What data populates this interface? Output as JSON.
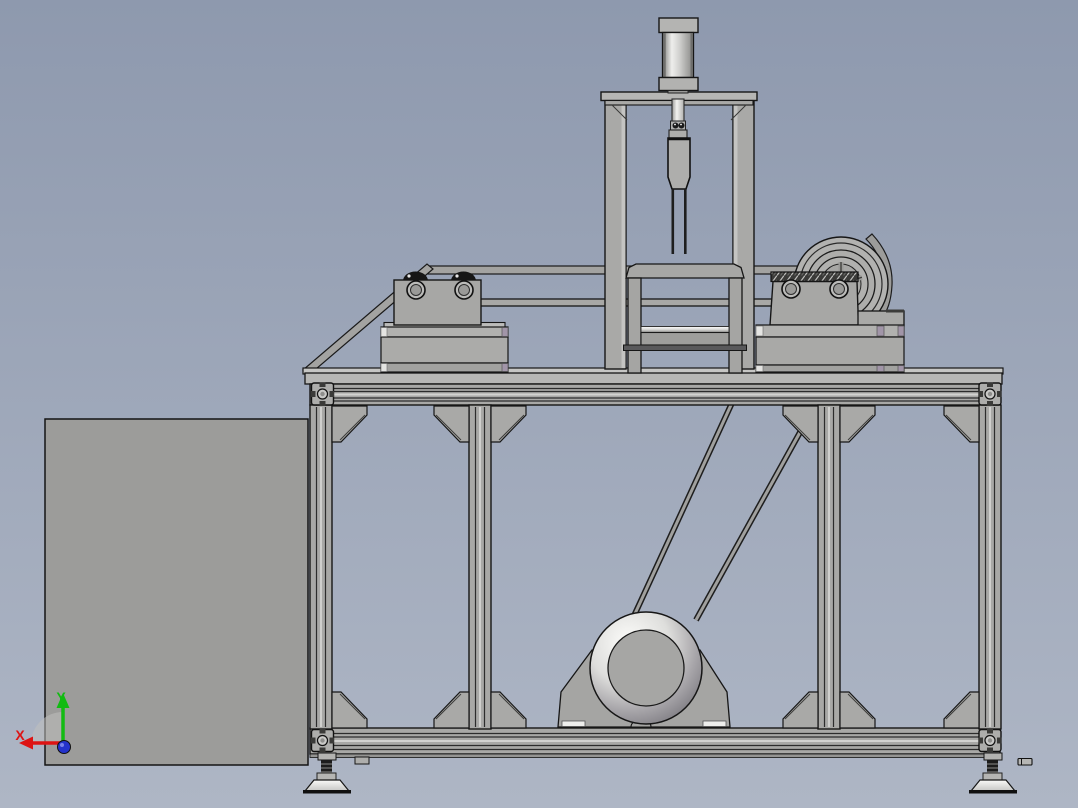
{
  "viewport": {
    "type": "cad-3d-viewport",
    "view_name": "front-view-machine-assembly",
    "background_top": "#8e99ae",
    "background_bottom": "#aeb6c5",
    "part_color": "#a9a9a7",
    "edge_color": "#1a1a1a",
    "panel_color": "#9c9c9a"
  },
  "orientation_triad": {
    "x_label": "X",
    "y_label": "Y",
    "x_axis_color": "#dd1414",
    "y_axis_color": "#12bb12",
    "z_axis_color": "#2433cc"
  }
}
